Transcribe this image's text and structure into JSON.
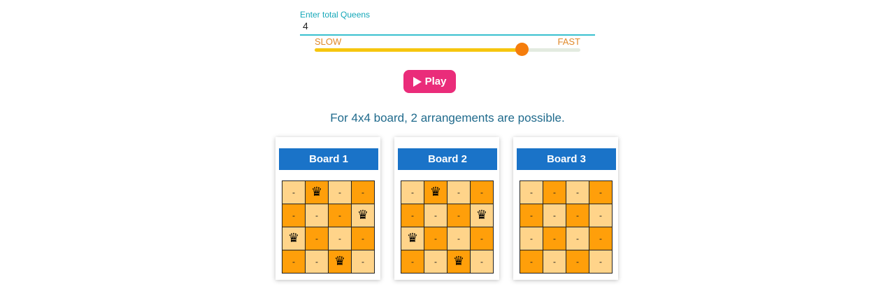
{
  "queens_input": {
    "label": "Enter total Queens",
    "value": "4"
  },
  "speed": {
    "slow_label": "SLOW",
    "fast_label": "FAST",
    "value": 0.78
  },
  "play_button": {
    "label": "Play",
    "icon": "play-icon"
  },
  "result_text": "For 4x4 board, 2 arrangements are possible.",
  "colors": {
    "accent": "#39c0cf",
    "play": "#ea2c7a",
    "board_header": "#1a73c8",
    "cell_light": "#ffd48a",
    "cell_dark": "#ff9f0a",
    "slider_fill": "#f6c60f",
    "slider_thumb": "#f57d0c"
  },
  "queen_symbol": "♛",
  "empty_symbol": "-",
  "boards": [
    {
      "title": "Board 1",
      "cells": [
        [
          "-",
          "Q",
          "-",
          "-"
        ],
        [
          "-",
          "-",
          "-",
          "Q"
        ],
        [
          "Q",
          "-",
          "-",
          "-"
        ],
        [
          "-",
          "-",
          "Q",
          "-"
        ]
      ]
    },
    {
      "title": "Board 2",
      "cells": [
        [
          "-",
          "Q",
          "-",
          "-"
        ],
        [
          "-",
          "-",
          "-",
          "Q"
        ],
        [
          "Q",
          "-",
          "-",
          "-"
        ],
        [
          "-",
          "-",
          "Q",
          "-"
        ]
      ]
    },
    {
      "title": "Board 3",
      "cells": [
        [
          "-",
          "-",
          "-",
          "-"
        ],
        [
          "-",
          "-",
          "-",
          "-"
        ],
        [
          "-",
          "-",
          "-",
          "-"
        ],
        [
          "-",
          "-",
          "-",
          "-"
        ]
      ]
    }
  ]
}
